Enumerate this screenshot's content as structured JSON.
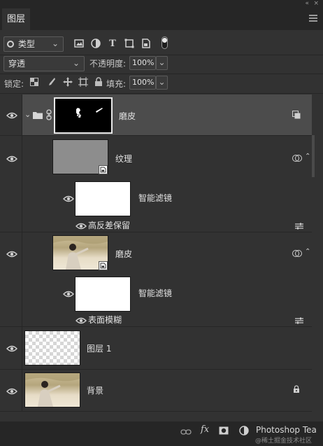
{
  "panel": {
    "tab_label": "图层",
    "collapse_glyph": "«",
    "close_glyph": "×"
  },
  "filter": {
    "kind_value": "类型",
    "icons": [
      "image-filter-icon",
      "adjustment-filter-icon",
      "type-filter-icon",
      "shape-filter-icon",
      "smart-object-filter-icon",
      "filter-toggle-icon"
    ]
  },
  "blend": {
    "mode_value": "穿透",
    "opacity_label": "不透明度:",
    "opacity_value": "100%"
  },
  "lock": {
    "label": "锁定:",
    "fill_label": "填充:",
    "fill_value": "100%"
  },
  "layers": [
    {
      "name": "磨皮",
      "type": "group"
    },
    {
      "name": "纹理",
      "type": "smart-object"
    },
    {
      "name": "智能滤镜",
      "type": "smart-filter"
    },
    {
      "name": "高反差保留",
      "type": "filter-effect"
    },
    {
      "name": "磨皮",
      "type": "smart-object"
    },
    {
      "name": "智能滤镜",
      "type": "smart-filter"
    },
    {
      "name": "表面模糊",
      "type": "filter-effect"
    },
    {
      "name": "图层 1",
      "type": "pixel"
    },
    {
      "name": "背景",
      "type": "background"
    }
  ],
  "bottom": {
    "fx_label": "fx",
    "watermark": "Photoshop Tea",
    "watermark_sub": "@稀土掘金技术社区"
  },
  "colors": {
    "panel_bg": "#323232",
    "selected_row": "#4c4c4c",
    "text": "#e2e2e2"
  }
}
